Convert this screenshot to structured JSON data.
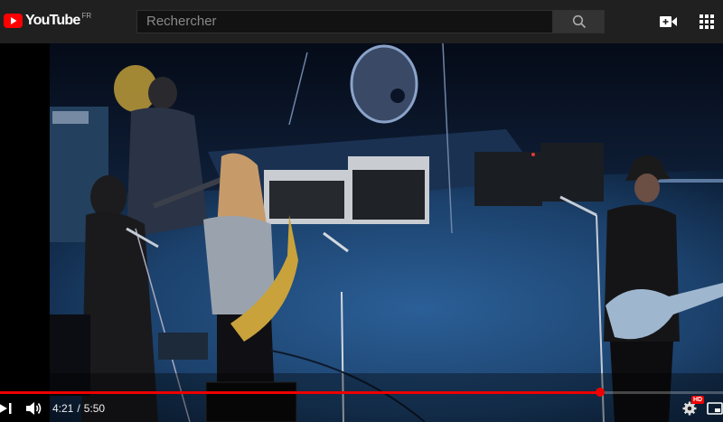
{
  "header": {
    "logo_text": "YouTube",
    "region": "FR",
    "search_placeholder": "Rechercher",
    "icons": [
      "youtube-logo-icon",
      "search-icon",
      "create-video-icon",
      "apps-grid-icon"
    ]
  },
  "player": {
    "current_time": "4:21",
    "separator": "/",
    "duration": "5:50",
    "progress_fraction": 0.83,
    "quality_badge": "HD",
    "icons": [
      "play-pause-icon",
      "volume-icon",
      "settings-icon",
      "miniplayer-icon"
    ]
  },
  "colors": {
    "accent": "#ff0000",
    "header_bg": "#202020",
    "search_bg": "#121212",
    "stage_blue": "#1e4a7a"
  }
}
